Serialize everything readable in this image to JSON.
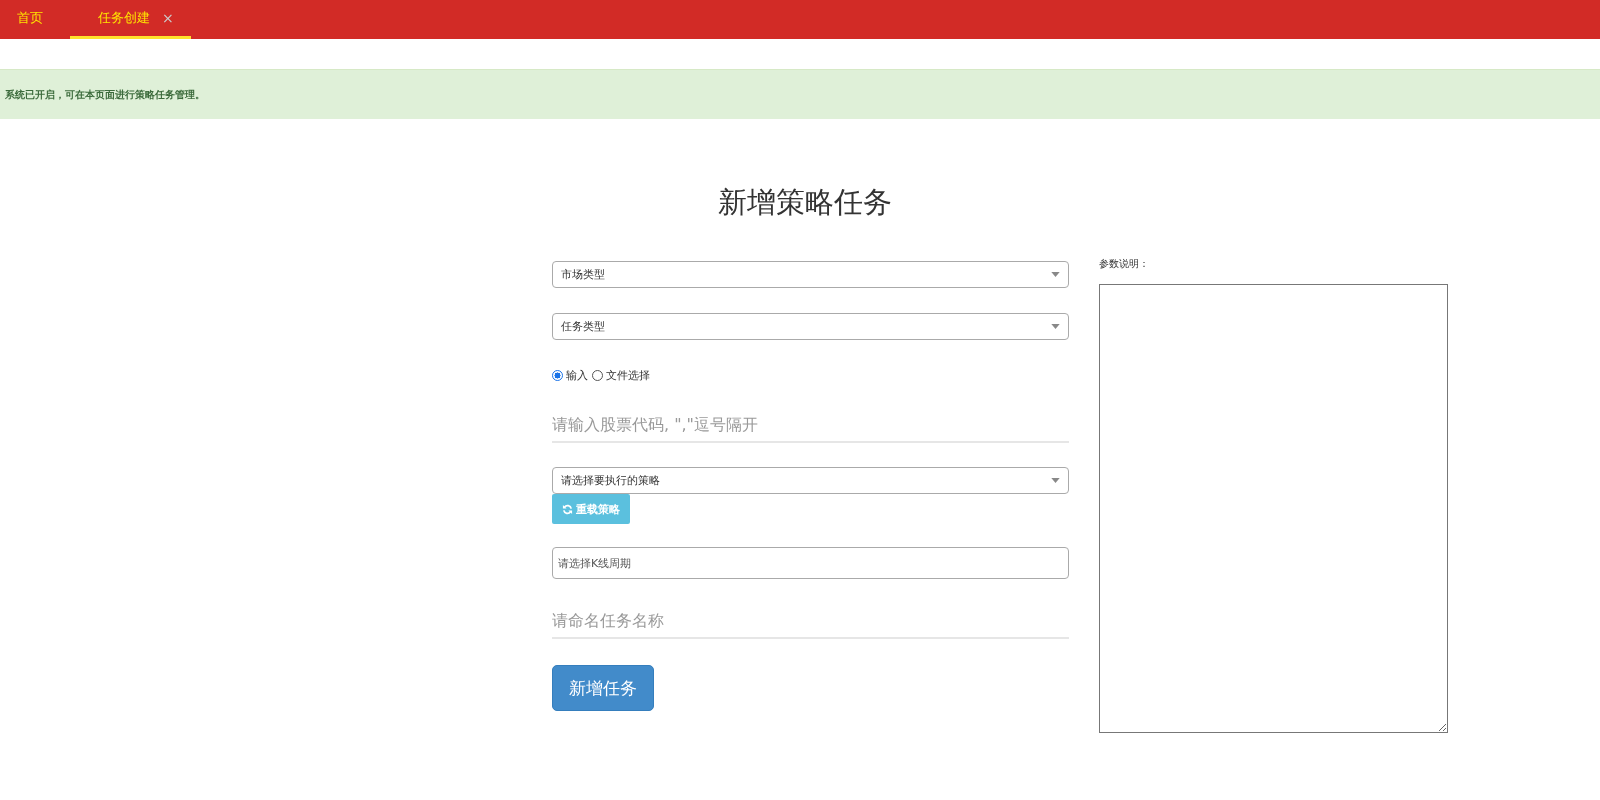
{
  "tabs": [
    {
      "label": "首页",
      "selected": false
    },
    {
      "label": "任务创建",
      "selected": true,
      "close": "×"
    }
  ],
  "alert": "系统已开启，可在本页面进行策略任务管理。",
  "title": "新增策略任务",
  "form": [
    {
      "kind": "select",
      "value": "市场类型"
    },
    {
      "kind": "select",
      "value": "任务类型"
    },
    {
      "kind": "radios",
      "options": [
        {
          "label": "输入",
          "selected": true
        },
        {
          "label": "文件选择",
          "selected": false
        }
      ]
    },
    {
      "kind": "line",
      "placeholder": "请输入股票代码, \",\"逗号隔开"
    },
    {
      "kind": "select",
      "value": "请选择要执行的策略",
      "button": "重载策略"
    },
    {
      "kind": "box",
      "placeholder": "请选择K线周期"
    },
    {
      "kind": "line",
      "placeholder": "请命名任务名称"
    },
    {
      "kind": "submit",
      "label": "新增任务"
    }
  ],
  "params": {
    "label": "参数说明："
  }
}
